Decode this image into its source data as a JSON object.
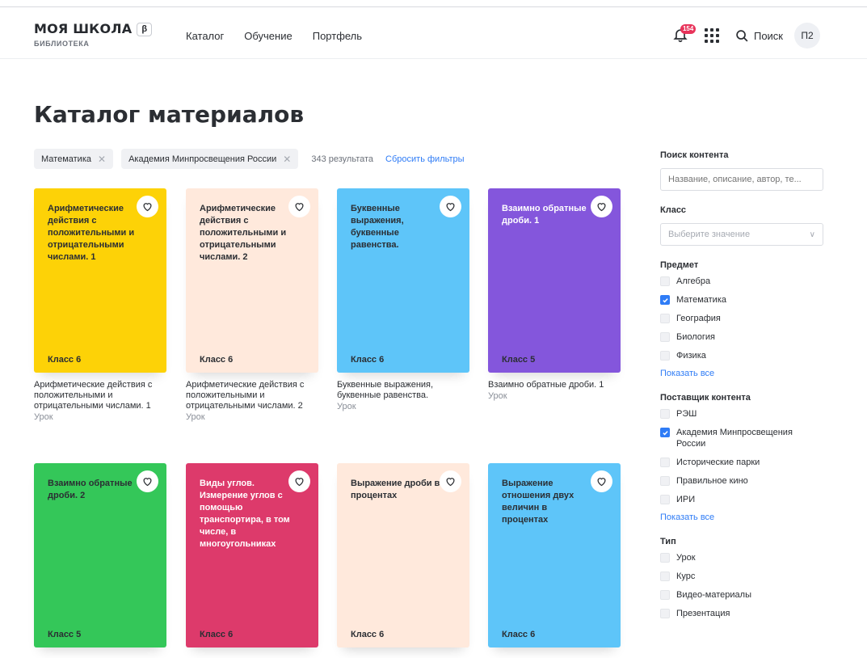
{
  "header": {
    "logo_title": "МОЯ ШКОЛА",
    "beta": "β",
    "logo_sub": "БИБЛИОТЕКА",
    "nav": [
      "Каталог",
      "Обучение",
      "Портфель"
    ],
    "notifications_count": "154",
    "search_label": "Поиск",
    "avatar": "П2"
  },
  "page": {
    "title": "Каталог материалов"
  },
  "filters": {
    "chips": [
      "Математика",
      "Академия Минпросвещения России"
    ],
    "results": "343 результата",
    "reset": "Сбросить фильтры"
  },
  "cards": [
    {
      "title": "Арифметические действия с положительными и отрицательными числами. 1",
      "class": "Класс 6",
      "desc": "Арифметические действия с положительными и отрицательными числами. 1",
      "type": "Урок",
      "color": "#fdd207"
    },
    {
      "title": "Арифметические действия с положительными и отрицательными числами. 2",
      "class": "Класс 6",
      "desc": "Арифметические действия с положительными и отрицательными числами. 2",
      "type": "Урок",
      "color": "#ffe9dc"
    },
    {
      "title": "Буквенные выражения, буквенные равенства.",
      "class": "Класс 6",
      "desc": "Буквенные выражения, буквенные равенства.",
      "type": "Урок",
      "color": "#5ec5f9"
    },
    {
      "title": "Взаимно обратные дроби. 1",
      "class": "Класс 5",
      "desc": "Взаимно обратные дроби. 1",
      "type": "Урок",
      "color": "#8456dc"
    },
    {
      "title": "Взаимно обратные дроби. 2",
      "class": "Класс 5",
      "color": "#34c759"
    },
    {
      "title": "Виды углов. Измерение углов с помощью транспортира, в том числе, в многоугольниках",
      "class": "Класс 6",
      "color": "#dd3a6b"
    },
    {
      "title": "Выражение дроби в процентах",
      "class": "Класс 6",
      "color": "#ffe9dc"
    },
    {
      "title": "Выражение отношения двух величин в процентах",
      "class": "Класс 6",
      "color": "#5ec5f9"
    }
  ],
  "sidebar": {
    "search_head": "Поиск контента",
    "search_placeholder": "Название, описание, автор, те...",
    "class_head": "Класс",
    "class_placeholder": "Выберите значение",
    "subject_head": "Предмет",
    "subjects": [
      {
        "label": "Алгебра",
        "checked": false
      },
      {
        "label": "Математика",
        "checked": true
      },
      {
        "label": "География",
        "checked": false
      },
      {
        "label": "Биология",
        "checked": false
      },
      {
        "label": "Физика",
        "checked": false
      }
    ],
    "show_all": "Показать все",
    "provider_head": "Поставщик контента",
    "providers": [
      {
        "label": "РЭШ",
        "checked": false
      },
      {
        "label": "Академия Минпросвещения России",
        "checked": true
      },
      {
        "label": "Исторические парки",
        "checked": false
      },
      {
        "label": "Правильное кино",
        "checked": false
      },
      {
        "label": "ИРИ",
        "checked": false
      }
    ],
    "type_head": "Тип",
    "types": [
      {
        "label": "Урок",
        "checked": false
      },
      {
        "label": "Курс",
        "checked": false
      },
      {
        "label": "Видео-материалы",
        "checked": false
      },
      {
        "label": "Презентация",
        "checked": false
      }
    ]
  },
  "colors": {
    "accent": "#2f7cf6",
    "badge": "#e8335a"
  }
}
